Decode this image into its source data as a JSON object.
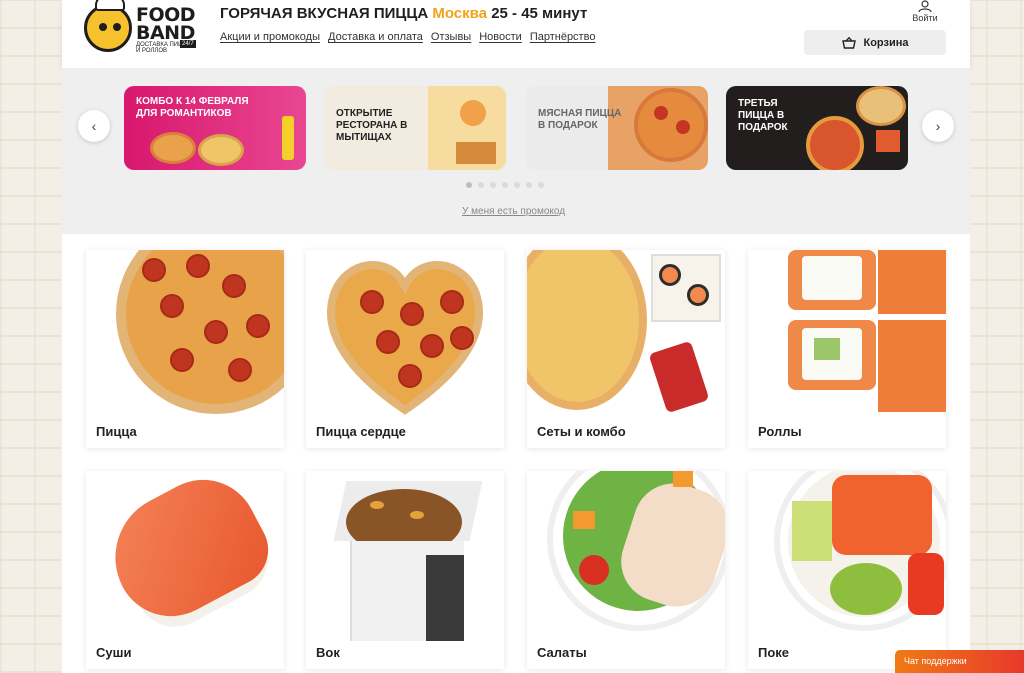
{
  "brand": {
    "logo_line1": "FOOD",
    "logo_line2": "BAND",
    "logo_sub": "ДОСТАВКА ПИЦЦЫ И РОЛЛОВ",
    "logo_badge": "24/7"
  },
  "header": {
    "title": "ГОРЯЧАЯ ВКУСНАЯ ПИЦЦА",
    "city": "Москва",
    "delivery_time": "25 - 45 минут",
    "login_label": "Войти",
    "cart_label": "Корзина"
  },
  "nav": {
    "items": [
      {
        "label": "Акции и промокоды"
      },
      {
        "label": "Доставка и оплата"
      },
      {
        "label": "Отзывы"
      },
      {
        "label": "Новости"
      },
      {
        "label": "Партнёрство"
      }
    ]
  },
  "banners": [
    {
      "text": "КОМБО К 14 ФЕВРАЛЯ ДЛЯ РОМАНТИКОВ",
      "color": "#d8176d"
    },
    {
      "text": "ОТКРЫТИЕ РЕСТОРАНА В МЫТИЩАХ",
      "color": "#f1ecdf"
    },
    {
      "text": "МЯСНАЯ ПИЦЦА В ПОДАРОК",
      "color": "#ebebeb"
    },
    {
      "text": "ТРЕТЬЯ ПИЦЦА В ПОДАРОК",
      "color": "#221e1d"
    }
  ],
  "carousel": {
    "prev_icon": "chevron-left-icon",
    "next_icon": "chevron-right-icon",
    "dot_count": 7,
    "active_dot": 1
  },
  "promo_link": "У меня есть промокод",
  "categories": [
    {
      "label": "Пицца"
    },
    {
      "label": "Пицца сердце"
    },
    {
      "label": "Сеты и комбо"
    },
    {
      "label": "Роллы"
    },
    {
      "label": "Суши"
    },
    {
      "label": "Вок"
    },
    {
      "label": "Салаты"
    },
    {
      "label": "Поке"
    }
  ],
  "support": {
    "label": "Чат поддержки"
  },
  "colors": {
    "accent": "#f2a21a",
    "support_gradient_start": "#f07a14",
    "support_gradient_end": "#e8392c"
  }
}
